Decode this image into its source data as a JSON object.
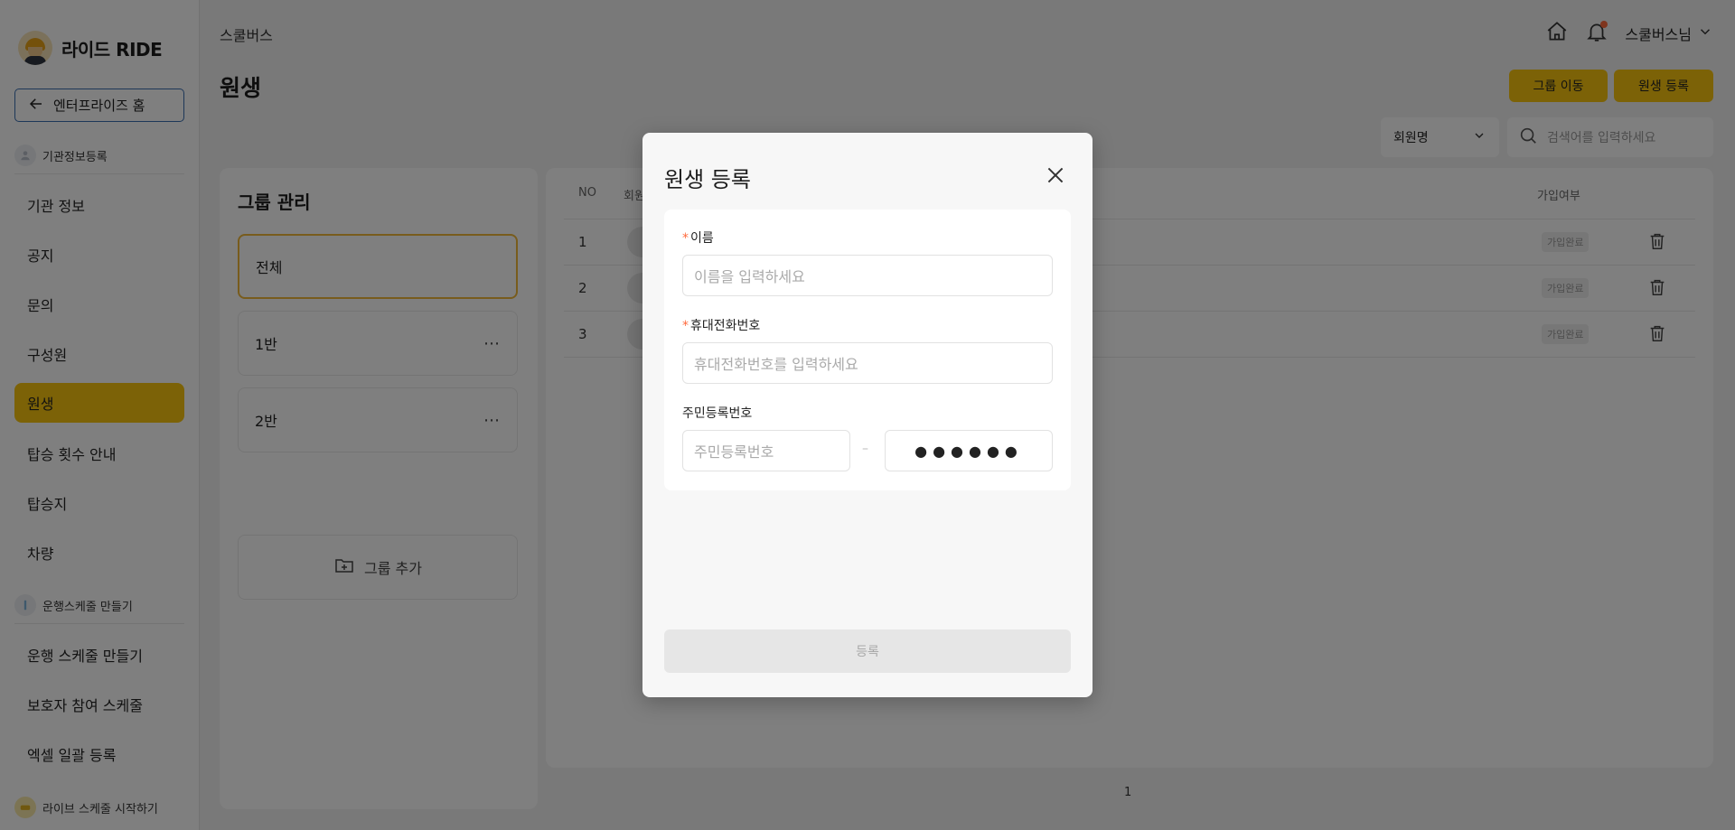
{
  "sidebar": {
    "logo_text": "라이드 RIDE",
    "home_button": "엔터프라이즈 홈",
    "sections": [
      {
        "title": "기관정보등록"
      },
      {
        "title": "운행스케줄 만들기"
      },
      {
        "title": "라이브 스케줄 시작하기"
      }
    ],
    "items": [
      {
        "label": "기관 정보"
      },
      {
        "label": "공지"
      },
      {
        "label": "문의"
      },
      {
        "label": "구성원"
      },
      {
        "label": "원생"
      },
      {
        "label": "탑승 횟수 안내"
      },
      {
        "label": "탑승지"
      },
      {
        "label": "차량"
      },
      {
        "label": "운행 스케줄 만들기"
      },
      {
        "label": "보호자 참여 스케줄"
      },
      {
        "label": "엑셀 일괄 등록"
      }
    ],
    "active_item": "원생"
  },
  "header": {
    "breadcrumb": "스쿨버스",
    "title": "원생",
    "user_name": "스쿨버스님",
    "group_move_button": "그룹 이동",
    "register_button": "원생 등록"
  },
  "filters": {
    "select_value": "회원명",
    "search_placeholder": "검색어를 입력하세요"
  },
  "groups": {
    "title": "그룹 관리",
    "items": [
      {
        "label": "전체"
      },
      {
        "label": "1반"
      },
      {
        "label": "2반"
      }
    ],
    "add_label": "그룹 추가"
  },
  "table": {
    "columns": {
      "no": "NO",
      "member": "회원",
      "joined": "가입여부"
    },
    "rows": [
      {
        "no": "1",
        "status": "가입완료"
      },
      {
        "no": "2",
        "status": "가입완료"
      },
      {
        "no": "3",
        "status": "가입완료"
      }
    ],
    "page": "1"
  },
  "modal": {
    "title": "원생 등록",
    "name_label": "이름",
    "name_placeholder": "이름을 입력하세요",
    "phone_label": "휴대전화번호",
    "phone_placeholder": "휴대전화번호를 입력하세요",
    "rrn_label": "주민등록번호",
    "rrn_placeholder": "주민등록번호",
    "rrn_separator": "–",
    "rrn_masked": "●●●●●●",
    "required_mark": "*",
    "submit_label": "등록"
  },
  "colors": {
    "accent": "#f8c40e",
    "required": "#ff6a3d",
    "overlay": "rgba(0,0,0,0.5)"
  }
}
